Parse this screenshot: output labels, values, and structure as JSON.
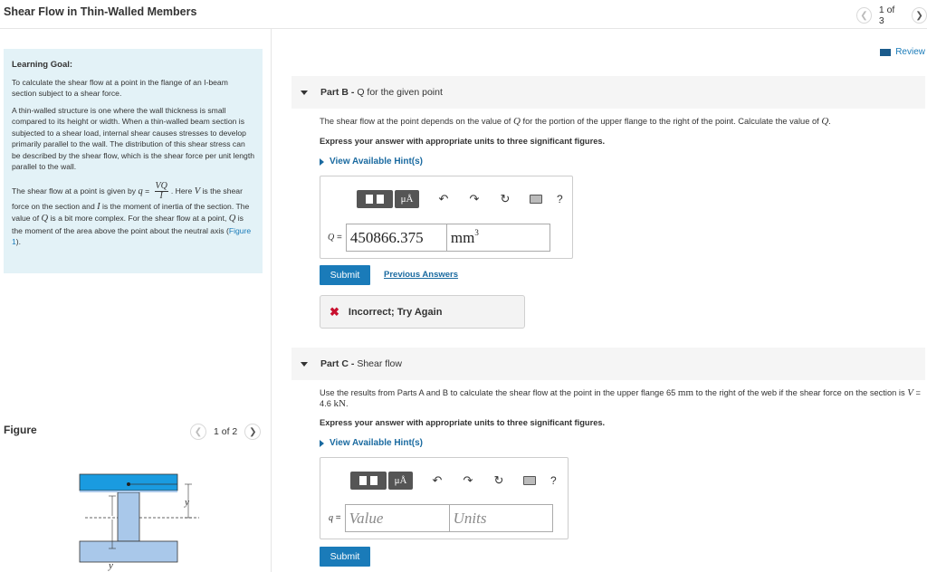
{
  "header": {
    "title": "Shear Flow in Thin-Walled Members",
    "pager": {
      "text": "1 of 3"
    }
  },
  "learning_goal": {
    "title": "Learning Goal:",
    "p1": "To calculate the shear flow at a point in the flange of an I-beam section subject to a shear force.",
    "p2": "A thin-walled structure is one where the wall thickness is small compared to its height or width. When a thin-walled beam section is subjected to a shear load, internal shear causes stresses to develop primarily parallel to the wall. The distribution of this shear stress can be described by the shear flow, which is the shear force per unit length parallel to the wall.",
    "p3_a": "The shear flow at a point is given by",
    "p3_q": "q",
    "p3_eq": " = ",
    "p3_num": "VQ",
    "p3_den": "I",
    "p3_b": ". Here",
    "p3_v": "V",
    "p3_c": "is the shear force on the section and",
    "p3_i": "I",
    "p3_d": "is the moment of inertia of the section. The value of",
    "p3_q2": "Q",
    "p3_e": "is a bit more complex. For the shear flow at a point,",
    "p3_q3": "Q",
    "p3_f": "is the moment of the area above the point about the neutral axis (",
    "p3_link": "Figure 1",
    "p3_g": ")."
  },
  "figure": {
    "label": "Figure",
    "pager": "1 of 2",
    "y_label": "y",
    "colors": {
      "flange": "#1a9be0",
      "web": "#a9c8ea"
    }
  },
  "review": {
    "label": "Review"
  },
  "part_b": {
    "prefix": "Part B -",
    "title": "Q for the given point",
    "text_a": "The shear flow at the point depends on the value of",
    "text_q": "Q",
    "text_b": "for the portion of the upper flange to the right of the point. Calculate the value of",
    "text_q2": "Q",
    "text_c": ".",
    "instruction": "Express your answer with appropriate units to three significant figures.",
    "hint": "View Available Hint(s)",
    "toolbar": {
      "mu": "μÅ",
      "q": "?"
    },
    "var_label": "Q",
    "eq": " = ",
    "value": "450866.375",
    "unit": "mm",
    "unit_exp": "3",
    "submit": "Submit",
    "previous": "Previous Answers",
    "feedback": "Incorrect; Try Again"
  },
  "part_c": {
    "prefix": "Part C -",
    "title": "Shear flow",
    "text_a": "Use the results from Parts A and B to calculate the shear flow at the point in the upper flange 65",
    "text_mm": "mm",
    "text_b": "to the right of the web if the shear force on the section is",
    "text_v": "V",
    "text_c": "= 4.6",
    "text_kn": "kN",
    "text_d": ".",
    "instruction": "Express your answer with appropriate units to three significant figures.",
    "hint": "View Available Hint(s)",
    "toolbar": {
      "mu": "μÅ",
      "q": "?"
    },
    "var_label": "q",
    "eq": " = ",
    "value_placeholder": "Value",
    "unit_placeholder": "Units",
    "submit": "Submit"
  },
  "colors": {
    "accent": "#1a7bb9",
    "goal_bg": "#e3f2f7",
    "error": "#c8102e"
  }
}
